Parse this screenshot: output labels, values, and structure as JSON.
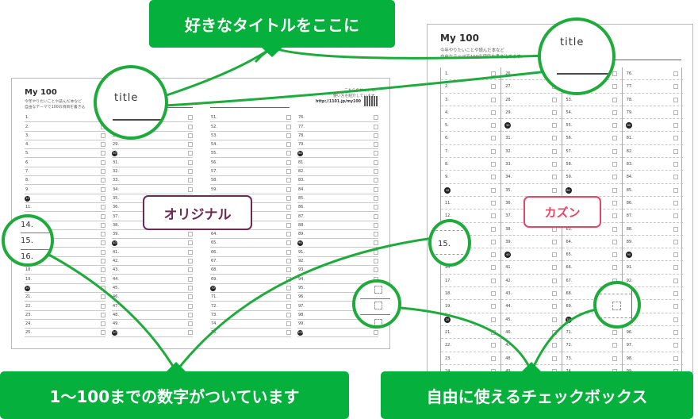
{
  "callouts": {
    "title_here": "好きなタイトルをここに",
    "numbers": "1〜100までの数字がついています",
    "checkboxes": "自由に使えるチェックボックス"
  },
  "tags": {
    "original": "オリジナル",
    "kazun": "カズン"
  },
  "sheet_original": {
    "title": "My 100",
    "desc_line1": "今年やりたいことや読んだ本など",
    "desc_line2": "自由なテーマで100の項目を書き込",
    "site_line1": "こちらのサイトで、",
    "site_line2": "使い方を紹介しています。",
    "site_url": "http://1101.jp/my100"
  },
  "sheet_kazun": {
    "title": "My 100",
    "desc_line1": "今年やりたいことや読んだ本など",
    "desc_line2": "自由なテーマで100の項目を書き込めます。"
  },
  "magnifiers": {
    "title_sample": "title",
    "number_samples": [
      "14.",
      "15.",
      "16."
    ],
    "kazun_number_sample": "15."
  },
  "list": {
    "count": 100,
    "badge_every": 10
  },
  "colors": {
    "green": "#06b03c",
    "original_accent": "#6c2c51",
    "kazun_accent": "#e64666"
  }
}
